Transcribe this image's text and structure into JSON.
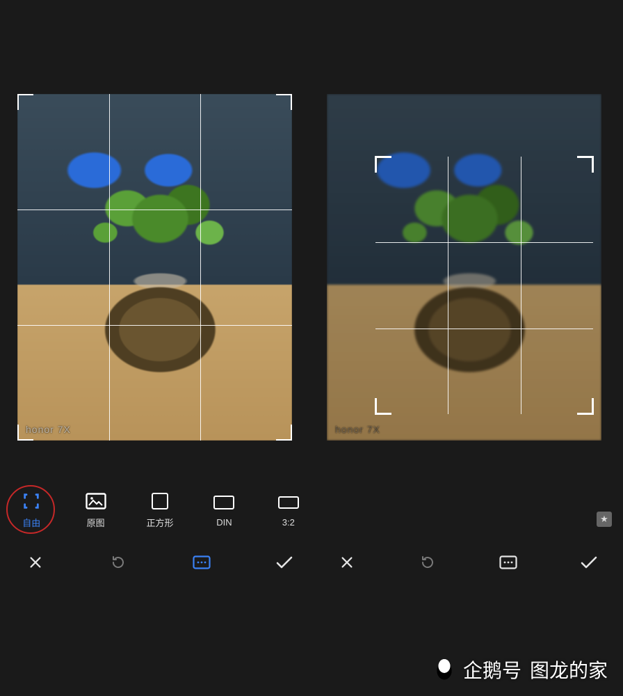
{
  "photo": {
    "device_watermark": "honor 7X"
  },
  "aspect_ratio_options": {
    "free": {
      "label": "自由",
      "selected": true,
      "highlighted": true
    },
    "original": {
      "label": "原图",
      "selected": false
    },
    "square": {
      "label": "正方形",
      "selected": false
    },
    "din": {
      "label": "DIN",
      "selected": false
    },
    "three_two": {
      "label": "3:2",
      "selected": false
    }
  },
  "action_bar": {
    "cancel": "cancel",
    "rotate": "rotate",
    "aspect": "aspect-menu",
    "confirm": "confirm"
  },
  "footer": {
    "channel": "企鹅号",
    "author": "图龙的家"
  }
}
